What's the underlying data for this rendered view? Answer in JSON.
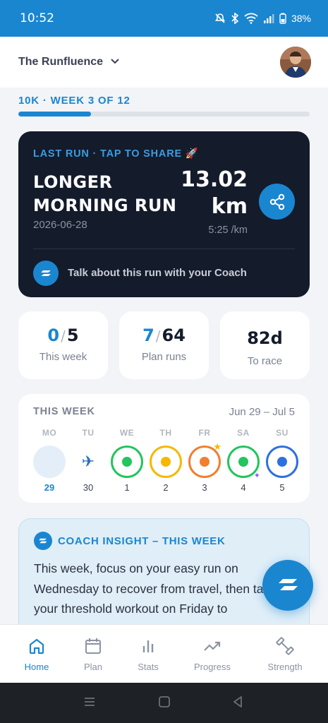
{
  "status_bar": {
    "time": "10:52",
    "battery": "38%"
  },
  "header": {
    "title": "The Runfluence"
  },
  "plan": {
    "label": "10K · WEEK 3 OF 12",
    "progress_fraction": 0.25
  },
  "last_run": {
    "kicker": "LAST RUN · TAP TO SHARE 🚀",
    "name": "LONGER MORNING RUN",
    "date": "2026-06-28",
    "distance": "13.02",
    "unit": "km",
    "pace": "5:25 /km",
    "coach_link": "Talk about this run with your Coach"
  },
  "stats": [
    {
      "value": "0",
      "total": "5",
      "label": "This week"
    },
    {
      "value": "7",
      "total": "64",
      "label": "Plan runs"
    },
    {
      "value": "82d",
      "label": "To race"
    }
  ],
  "week": {
    "title": "THIS WEEK",
    "range": "Jun 29 – Jul 5",
    "days": [
      {
        "label": "MO",
        "date": "29",
        "state": "today"
      },
      {
        "label": "TU",
        "date": "30",
        "state": "travel",
        "icon": "airplane-icon",
        "glyph": "✈"
      },
      {
        "label": "WE",
        "date": "1",
        "state": "easy",
        "color": "#22c55e"
      },
      {
        "label": "TH",
        "date": "2",
        "state": "moderate",
        "color": "#f5b800"
      },
      {
        "label": "FR",
        "date": "3",
        "state": "threshold",
        "color": "#f07f2f"
      },
      {
        "label": "SA",
        "date": "4",
        "state": "easy",
        "color": "#22c55e"
      },
      {
        "label": "SU",
        "date": "5",
        "state": "long",
        "color": "#2e6fe0"
      }
    ]
  },
  "insight": {
    "title": "COACH INSIGHT – THIS WEEK",
    "text": "This week, focus on your easy run on Wednesday to recover from travel, then tackle your threshold workout on Friday to"
  },
  "nav": [
    {
      "label": "Home",
      "icon": "home-icon",
      "active": true
    },
    {
      "label": "Plan",
      "icon": "calendar-icon"
    },
    {
      "label": "Stats",
      "icon": "bar-chart-icon"
    },
    {
      "label": "Progress",
      "icon": "trend-icon"
    },
    {
      "label": "Strength",
      "icon": "dumbbell-icon"
    }
  ],
  "colors": {
    "accent": "#1a86d0",
    "card_dark": "#141b2b",
    "status_bar": "#1a86d0"
  }
}
